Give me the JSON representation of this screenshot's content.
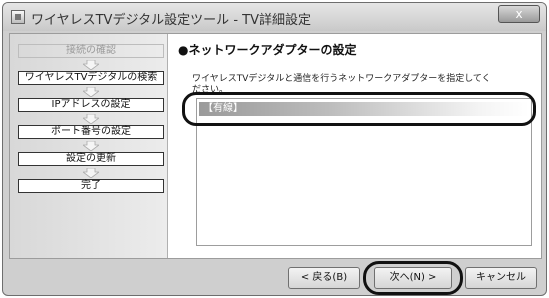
{
  "window": {
    "title": "ワイヤレスTVデジタル設定ツール - TV詳細設定",
    "close_label": "x"
  },
  "steps": [
    {
      "label": "接続の確認",
      "state": "done"
    },
    {
      "label": "ワイヤレスTVデジタルの検索",
      "state": "todo"
    },
    {
      "label": "IPアドレスの設定",
      "state": "todo"
    },
    {
      "label": "ポート番号の設定",
      "state": "todo"
    },
    {
      "label": "設定の更新",
      "state": "todo"
    },
    {
      "label": "完了",
      "state": "todo"
    }
  ],
  "main": {
    "title": "●ネットワークアダプターの設定",
    "description": "ワイヤレスTVデジタルと通信を行うネットワークアダプターを指定してください。",
    "adapter_selected": "【有線】"
  },
  "buttons": {
    "back": "< 戻る(B)",
    "next": "次へ(N) >",
    "cancel": "キャンセル"
  },
  "colors": {
    "highlight_ring": "#111111",
    "selection_gradient_start": "#9a9a9a"
  },
  "icons": [
    "app-icon",
    "close-icon",
    "down-arrow-icon"
  ]
}
